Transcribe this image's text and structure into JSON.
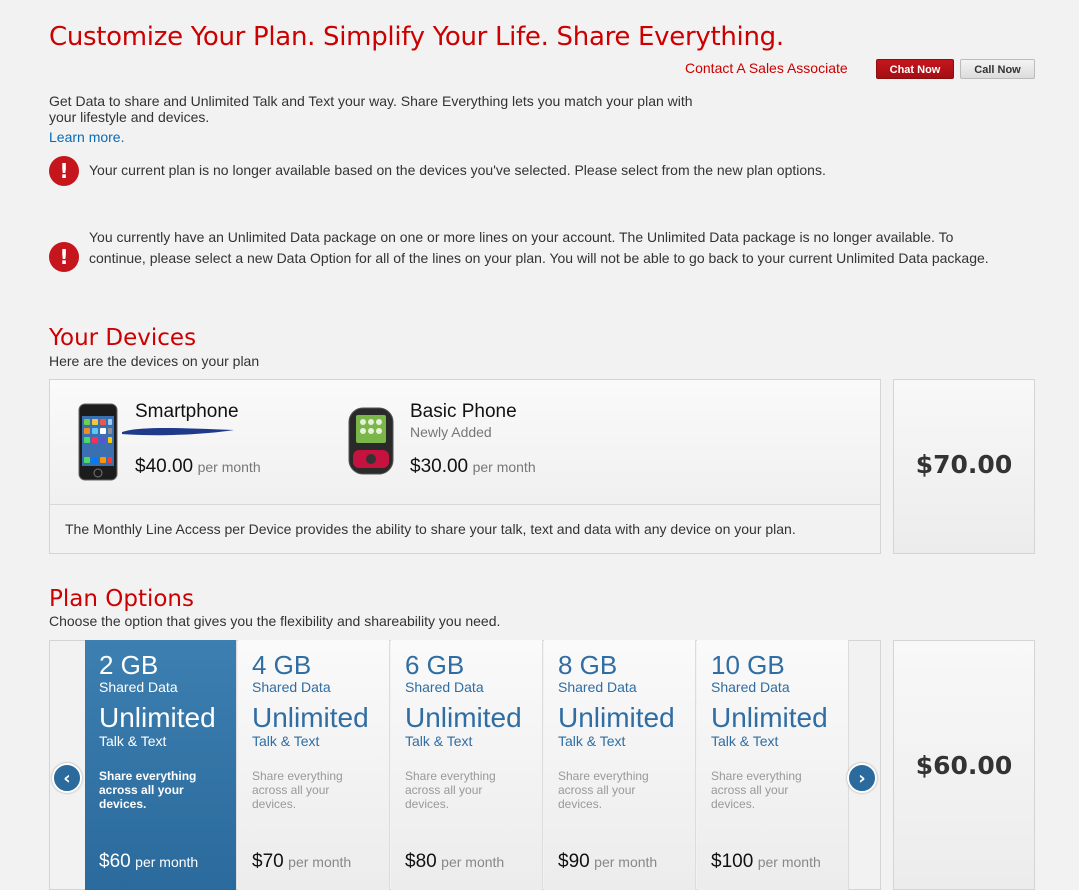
{
  "header": {
    "title": "Customize Your Plan. Simplify Your Life. Share Everything.",
    "contact_label": "Contact A Sales Associate",
    "chat_button": "Chat Now",
    "call_button": "Call Now"
  },
  "intro": {
    "text": "Get Data to share and Unlimited Talk and Text your way. Share Everything lets you match your plan with your lifestyle and devices.",
    "learn_more": "Learn more."
  },
  "alerts": [
    {
      "icon": "!",
      "text": "Your current plan is no longer available based on the devices you've selected. Please select from the new plan options."
    },
    {
      "icon": "!",
      "text": "You currently have an Unlimited Data package on one or more lines on your account. The Unlimited Data package is no longer available. To continue, please select a new Data Option for all of the lines on your plan. You will not be able to go back to your current Unlimited Data package."
    }
  ],
  "devices": {
    "title": "Your Devices",
    "subtitle": "Here are the devices on your plan",
    "items": [
      {
        "name": "Smartphone",
        "status": "",
        "price": "$40.00",
        "per": "per month",
        "icon": "smartphone-image"
      },
      {
        "name": "Basic Phone",
        "status": "Newly Added",
        "price": "$30.00",
        "per": "per month",
        "icon": "basic-phone-image"
      }
    ],
    "footer": "The Monthly Line Access per Device provides the ability to share your talk, text and data with any device on your plan.",
    "total": "$70.00"
  },
  "plans": {
    "title": "Plan Options",
    "subtitle": "Choose the option that gives you the flexibility and shareability you need.",
    "items": [
      {
        "gb": "2 GB",
        "shared": "Shared Data",
        "unlimited": "Unlimited",
        "talk": "Talk & Text",
        "desc": "Share everything across all your devices.",
        "price": "$60",
        "per": "per month",
        "selected": true
      },
      {
        "gb": "4 GB",
        "shared": "Shared Data",
        "unlimited": "Unlimited",
        "talk": "Talk & Text",
        "desc": "Share everything across all your devices.",
        "price": "$70",
        "per": "per month",
        "selected": false
      },
      {
        "gb": "6 GB",
        "shared": "Shared Data",
        "unlimited": "Unlimited",
        "talk": "Talk & Text",
        "desc": "Share everything across all your devices.",
        "price": "$80",
        "per": "per month",
        "selected": false
      },
      {
        "gb": "8 GB",
        "shared": "Shared Data",
        "unlimited": "Unlimited",
        "talk": "Talk & Text",
        "desc": "Share everything across all your devices.",
        "price": "$90",
        "per": "per month",
        "selected": false
      },
      {
        "gb": "10 GB",
        "shared": "Shared Data",
        "unlimited": "Unlimited",
        "talk": "Talk & Text",
        "desc": "Share everything across all your devices.",
        "price": "$100",
        "per": "per month",
        "selected": false
      }
    ],
    "prev_icon": "chevron-left-icon",
    "next_icon": "chevron-right-icon",
    "total": "$60.00"
  },
  "colors": {
    "brand_red": "#c4161c",
    "link_blue": "#0a6ab1",
    "plan_blue": "#2f6da3",
    "selected_blue": "#2a6a9c"
  }
}
